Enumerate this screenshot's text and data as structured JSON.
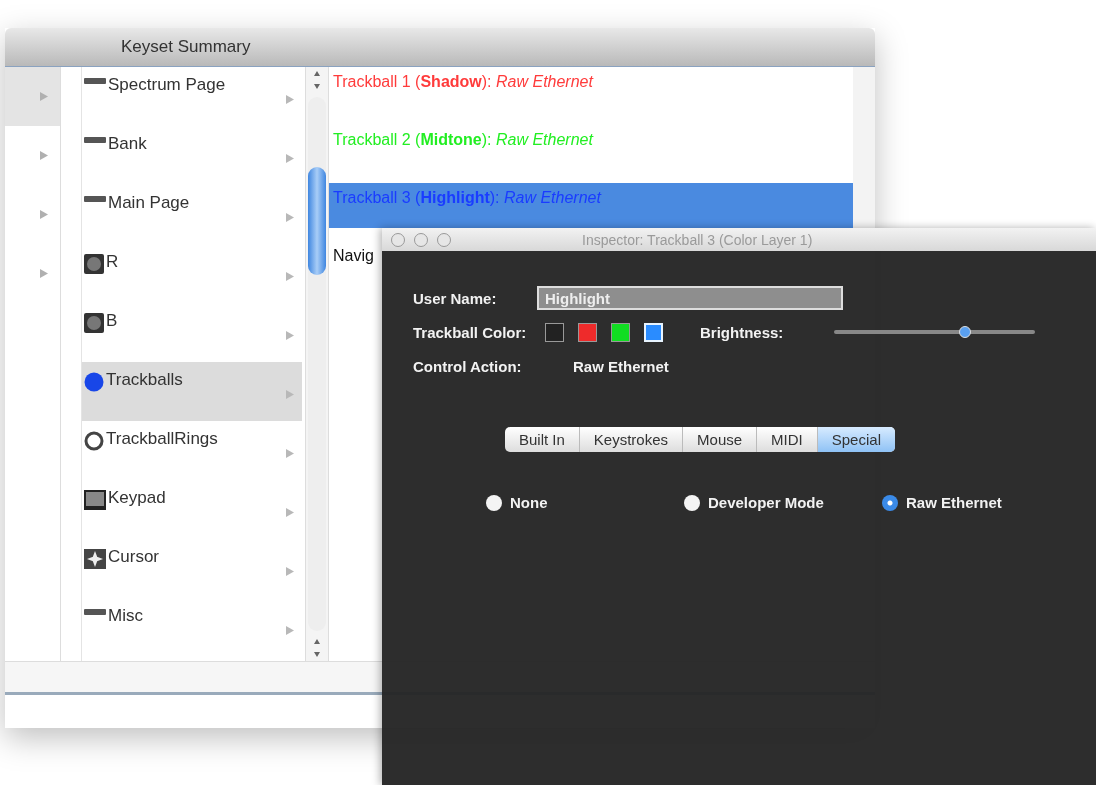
{
  "keyset_window": {
    "title": "Keyset Summary",
    "column_1": [
      {
        "selected": true
      },
      {
        "selected": false
      },
      {
        "selected": false
      },
      {
        "selected": false
      }
    ],
    "column_2": [
      {
        "label": "Spectrum Page",
        "kind": "bar",
        "selected": false
      },
      {
        "label": "Bank",
        "kind": "bar",
        "selected": false
      },
      {
        "label": "Main Page",
        "kind": "bar",
        "selected": false
      },
      {
        "label": "R",
        "kind": "square",
        "selected": false
      },
      {
        "label": "B",
        "kind": "square",
        "selected": false
      },
      {
        "label": "Trackballs",
        "kind": "ball",
        "selected": true
      },
      {
        "label": "TrackballRings",
        "kind": "ring",
        "selected": false
      },
      {
        "label": "Keypad",
        "kind": "keypad",
        "selected": false
      },
      {
        "label": "Cursor",
        "kind": "cursor",
        "selected": false
      },
      {
        "label": "Misc",
        "kind": "bar",
        "selected": false
      }
    ],
    "column_3": [
      {
        "text": "Trackball 1 (**Shadow**): *Raw Ethernet*",
        "color": "#ff3b3b",
        "selected": false
      },
      {
        "text": "Trackball 2 (**Midtone**): *Raw Ethernet*",
        "color": "#22ee22",
        "selected": false
      },
      {
        "text": "Trackball 3 (**Highlight**): *Raw Ethernet*",
        "color": "#1a3cff",
        "selected": true
      },
      {
        "text": "Navig",
        "color": "#111111",
        "selected": false
      }
    ]
  },
  "inspector": {
    "title": "Inspector: Trackball 3 (Color Layer 1)",
    "user_name_label": "User Name:",
    "user_name_value": "Highlight",
    "trackball_color_label": "Trackball Color:",
    "colors": [
      {
        "color": "#222222",
        "selected": false
      },
      {
        "color": "#ee2b2b",
        "selected": false
      },
      {
        "color": "#11dd22",
        "selected": false
      },
      {
        "color": "#2a8cff",
        "selected": true
      }
    ],
    "brightness_label": "Brightness:",
    "brightness": {
      "level": 0.65
    },
    "control_action_label": "Control Action:",
    "control_action_value": "Raw Ethernet",
    "tabs": [
      {
        "label": "Built In",
        "selected": false
      },
      {
        "label": "Keystrokes",
        "selected": false
      },
      {
        "label": "Mouse",
        "selected": false
      },
      {
        "label": "MIDI",
        "selected": false
      },
      {
        "label": "Special",
        "selected": true
      }
    ],
    "options": [
      {
        "label": "None",
        "selected": false
      },
      {
        "label": "Developer Mode",
        "selected": false
      },
      {
        "label": "Raw Ethernet",
        "selected": true
      }
    ]
  }
}
